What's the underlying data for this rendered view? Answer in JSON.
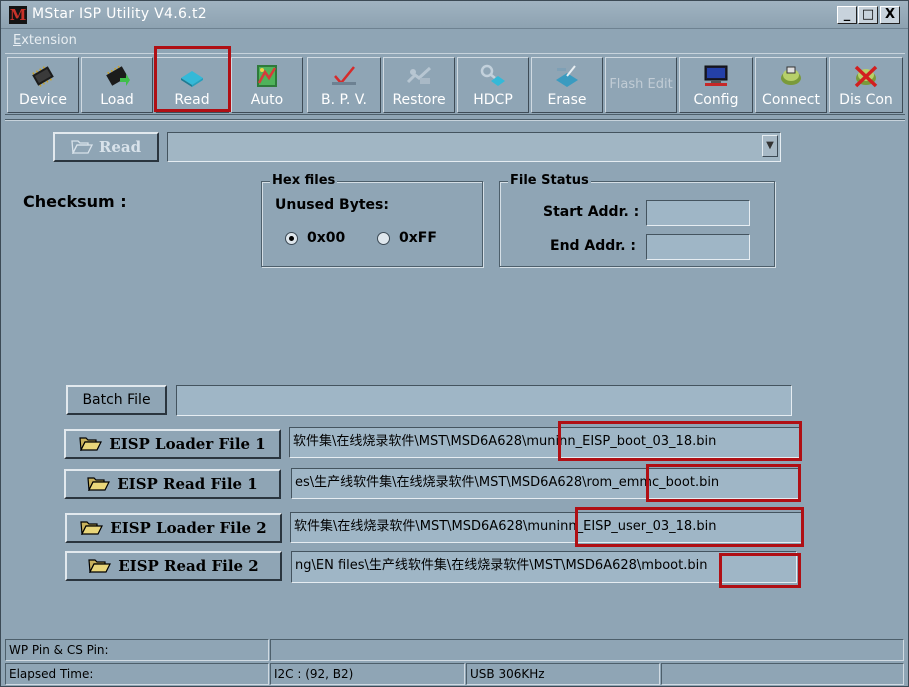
{
  "window": {
    "title": "MStar ISP Utility V4.6.t2",
    "icon_letter": "M",
    "minimize": "_",
    "maximize": "□",
    "close": "X"
  },
  "menu": {
    "extension_first": "E",
    "extension_rest": "xtension"
  },
  "toolbar": {
    "buttons": [
      {
        "label": "Device",
        "icon": "device-chip-icon"
      },
      {
        "label": "Load",
        "icon": "load-chip-icon"
      },
      {
        "label": "Read",
        "icon": "read-chip-icon"
      },
      {
        "label": "Auto",
        "icon": "auto-icon"
      },
      {
        "label": "B. P. V.",
        "icon": "bpv-check-icon"
      },
      {
        "label": "Restore",
        "icon": "restore-icon"
      },
      {
        "label": "HDCP",
        "icon": "hdcp-icon"
      },
      {
        "label": "Erase",
        "icon": "erase-icon"
      },
      {
        "label": "Flash Edit",
        "icon": ""
      },
      {
        "label": "Config",
        "icon": "config-monitor-icon"
      },
      {
        "label": "Connect",
        "icon": "connect-plug-icon"
      },
      {
        "label": "Dis Con",
        "icon": "disconnect-plug-icon"
      }
    ]
  },
  "read_panel": {
    "read_button": "Read",
    "read_combo_value": "",
    "checksum_label": "Checksum :"
  },
  "hex_files": {
    "title": "Hex files",
    "unused_label": "Unused Bytes:",
    "option_0x00": "0x00",
    "option_0xff": "0xFF",
    "selected": "0x00"
  },
  "file_status": {
    "title": "File Status",
    "start_label": "Start Addr. :",
    "end_label": "End Addr. :",
    "start_value": "",
    "end_value": ""
  },
  "files": {
    "batch_label": "Batch File",
    "batch_value": "",
    "loader1_label": "EISP Loader File 1",
    "loader1_path": "软件集\\在线烧录软件\\MST\\MSD6A628\\muninn_EISP_boot_03_18.bin",
    "read1_label": "EISP Read File 1",
    "read1_path": "es\\生产线软件集\\在线烧录软件\\MST\\MSD6A628\\rom_emmc_boot.bin",
    "loader2_label": "EISP Loader File 2",
    "loader2_path": "软件集\\在线烧录软件\\MST\\MSD6A628\\muninn_EISP_user_03_18.bin",
    "read2_label": "EISP Read File 2",
    "read2_path": "ng\\EN files\\生产线软件集\\在线烧录软件\\MST\\MSD6A628\\mboot.bin"
  },
  "status": {
    "wp_pin": "WP Pin & CS Pin:",
    "wp_value": "",
    "elapsed": "Elapsed Time:",
    "i2c": "I2C : (92, B2)",
    "usb": "USB  306KHz",
    "extra": ""
  },
  "colors": {
    "background": "#8fa5b5",
    "highlight": "#b00f14"
  }
}
